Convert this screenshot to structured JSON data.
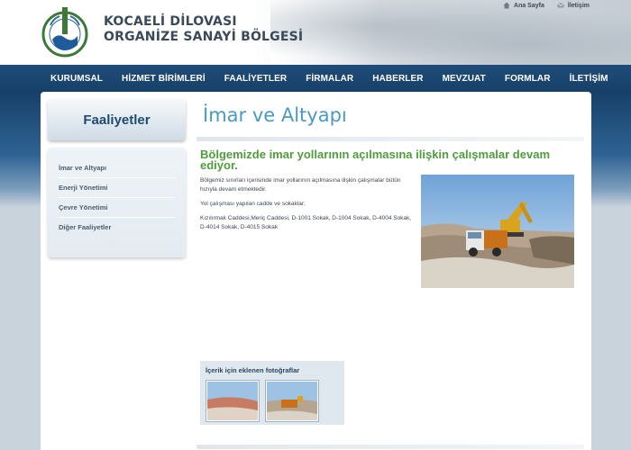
{
  "header": {
    "brand_line1": "KOCAELİ DİLOVASI",
    "brand_line2": "ORGANİZE SANAYİ BÖLGESİ",
    "links": [
      {
        "label": "Ana Sayfa",
        "icon": "home-icon"
      },
      {
        "label": "İletişim",
        "icon": "mail-icon"
      }
    ]
  },
  "nav": {
    "items": [
      "KURUMSAL",
      "HİZMET BİRİMLERİ",
      "FAALİYETLER",
      "FİRMALAR",
      "HABERLER",
      "MEVZUAT",
      "FORMLAR",
      "İLETİŞİM"
    ]
  },
  "sidebar": {
    "title": "Faaliyetler",
    "items": [
      "İmar ve Altyapı",
      "Enerji Yönetimi",
      "Çevre Yönetimi",
      "Diğer Faaliyetler"
    ]
  },
  "main": {
    "page_title": "İmar ve Altyapı",
    "headline": "Bölgemizde imar yollarının açılmasına ilişkin çalışmalar devam ediyor.",
    "paragraphs": [
      "Bölgemiz sınırları içerisinde imar yollarının açılmasına ilişkin çalışmalar bütün hızıyla devam etmektedir.",
      "Yol çalışması yapılan cadde ve sokaklar;",
      "Kızılırmak Caddesi,Meriç Caddesi, D-1001 Sokak, D-1004 Sokak, D-4004 Sokak, D-4014 Sokak, D-4015 Sokak"
    ],
    "gallery_title": "İçerik için eklenen fotoğraflar"
  },
  "colors": {
    "nav_bg": "#1f4d79",
    "headline": "#4e9e3c",
    "page_title": "#4a9ac0",
    "sidebar_title": "#1e4a72"
  }
}
